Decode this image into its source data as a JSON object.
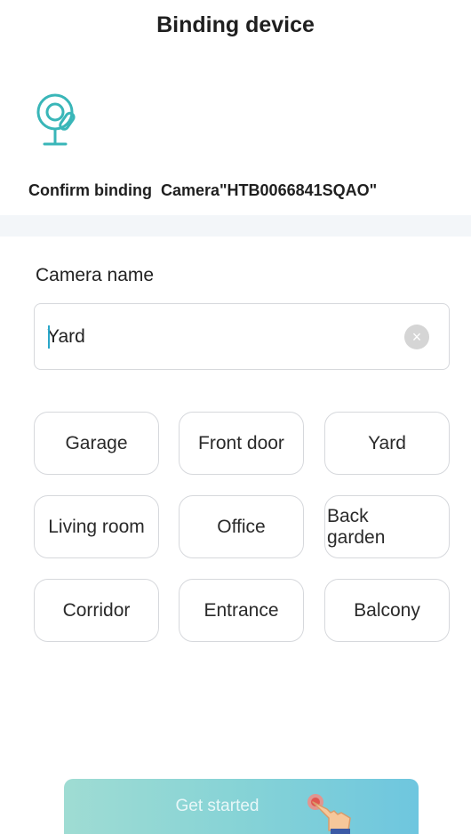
{
  "header": {
    "title": "Binding device"
  },
  "device": {
    "icon": "camera-icon",
    "confirm_text": "Confirm binding  Camera\"HTB0066841SQAO\""
  },
  "form": {
    "label": "Camera name",
    "input_value": "Yard",
    "clear_icon": "clear-icon"
  },
  "suggestions": [
    {
      "label": "Garage"
    },
    {
      "label": "Front door"
    },
    {
      "label": "Yard"
    },
    {
      "label": "Living room"
    },
    {
      "label": "Office"
    },
    {
      "label": "Back\ngarden"
    },
    {
      "label": "Corridor"
    },
    {
      "label": "Entrance"
    },
    {
      "label": "Balcony"
    }
  ],
  "footer": {
    "button_label": "Get started",
    "hand_icon": "pointing-hand-icon"
  },
  "colors": {
    "accent": "#2aa7c9",
    "button_gradient_start": "#9fdcd3",
    "button_gradient_end": "#6ec6df",
    "icon_teal": "#39b6b8"
  }
}
